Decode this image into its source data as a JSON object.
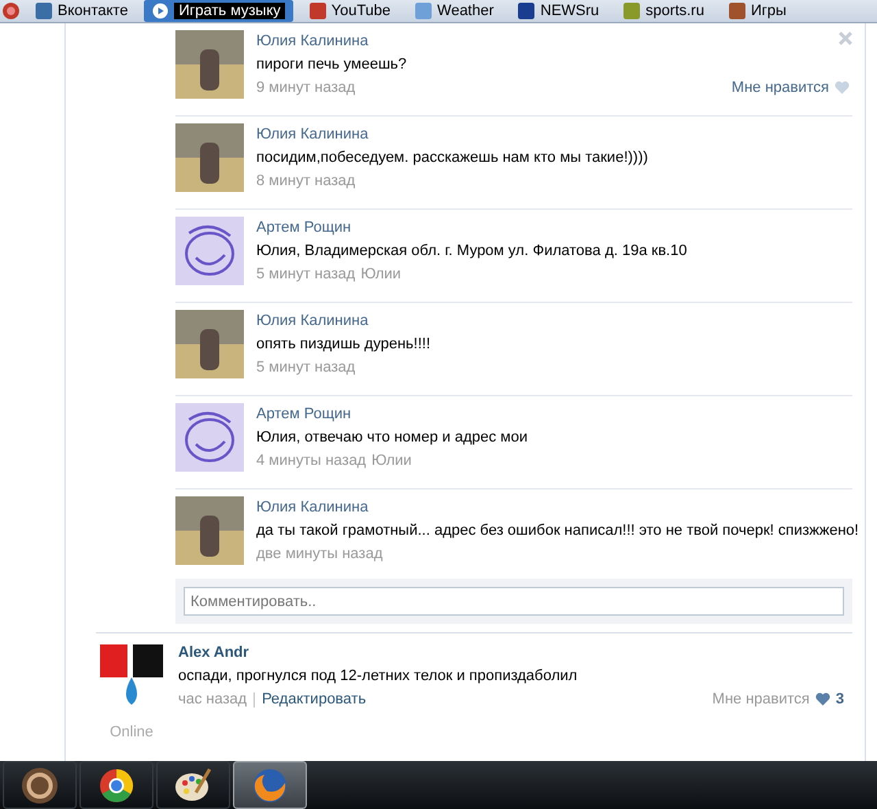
{
  "bookmarks": [
    {
      "label": "Вконтакте",
      "kind": "link"
    },
    {
      "label": "Играть музыку",
      "kind": "player"
    },
    {
      "label": "YouTube",
      "kind": "link"
    },
    {
      "label": "Weather",
      "kind": "link"
    },
    {
      "label": "NEWSru",
      "kind": "link"
    },
    {
      "label": "sports.ru",
      "kind": "link"
    },
    {
      "label": "Игры",
      "kind": "link"
    }
  ],
  "comments": [
    {
      "author": "Юлия Калинина",
      "kind": "photo",
      "text": "пироги печь умеешь?",
      "time": "9 минут назад",
      "like_label": "Мне нравится",
      "closable": true
    },
    {
      "author": "Юлия Калинина",
      "kind": "photo",
      "text": "посидим,побеседуем. расскажешь нам кто мы такие!))))",
      "time": "8 минут назад",
      "closable": false
    },
    {
      "author": "Артем Рощин",
      "kind": "sketch",
      "text": "Юлия, Владимерская обл. г. Муром ул. Филатова д. 19а кв.10",
      "time": "5 минут назад",
      "reply_to": "Юлии",
      "closable": false
    },
    {
      "author": "Юлия Калинина",
      "kind": "photo",
      "text": "опять пиздишь дурень!!!!",
      "time": "5 минут назад",
      "closable": false
    },
    {
      "author": "Артем Рощин",
      "kind": "sketch",
      "text": "Юлия, отвечаю что номер и адрес мои",
      "time": "4 минуты назад",
      "reply_to": "Юлии",
      "closable": false
    },
    {
      "author": "Юлия Калинина",
      "kind": "photo",
      "text": "да ты такой грамотный... адрес без ошибок написал!!! это не твой почерк! спизжжено!",
      "time": "две минуты назад",
      "closable": false
    }
  ],
  "comment_field": {
    "placeholder": "Комментировать.."
  },
  "post": {
    "author": "Alex Andr",
    "status": "Online",
    "text": "оспади, прогнулся под 12-летних телок и пропиздаболил",
    "time": "час назад",
    "edit": "Редактировать",
    "like_label": "Мне нравится",
    "like_count": "3",
    "liked": true
  },
  "taskbar": [
    {
      "kind": "start",
      "selected": false
    },
    {
      "kind": "ball",
      "selected": false
    },
    {
      "kind": "palette",
      "selected": false
    },
    {
      "kind": "globe",
      "selected": true
    }
  ]
}
